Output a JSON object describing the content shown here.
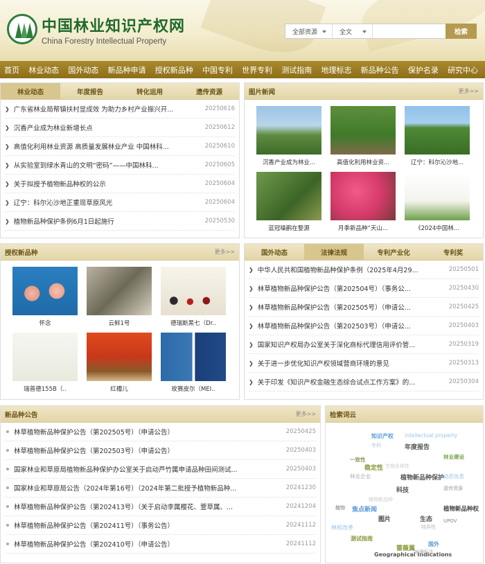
{
  "site": {
    "title_cn": "中国林业知识产权网",
    "title_en": "China Forestry Intellectual Property"
  },
  "search": {
    "scope": "全部资源",
    "field": "全文",
    "placeholder": "",
    "button": "检索"
  },
  "nav": [
    "首页",
    "林业动态",
    "国外动态",
    "新品种申请",
    "授权新品种",
    "中国专利",
    "世界专利",
    "测试指南",
    "地理标志",
    "新品种公告",
    "保护名录",
    "研究中心"
  ],
  "news": {
    "tabs": [
      "林业动态",
      "年度报告",
      "转化运用",
      "遗传资源"
    ],
    "items": [
      {
        "title": "广东省林业局帮镇扶村显成效 为助力乡村产业振兴开...",
        "date": "20250616"
      },
      {
        "title": "沉香产业成为林业新增长点",
        "date": "20250612"
      },
      {
        "title": "高值化利用林业资源 高质量发展林业产业 中国林科...",
        "date": "20250610"
      },
      {
        "title": "从实验室到绿水青山的文明“密码”——中国林科...",
        "date": "20250605"
      },
      {
        "title": "关于拟授予植物新品种权的公示",
        "date": "20250604"
      },
      {
        "title": "辽宁：科尔沁沙地正重现草原风光",
        "date": "20250604"
      },
      {
        "title": "植物新品种保护条例6月1日起施行",
        "date": "20250530"
      }
    ]
  },
  "photo_news": {
    "title": "图片新闻",
    "more": "更多>>",
    "items": [
      "沉香产业成为林业...",
      "高值化利用林业资...",
      "辽宁：科尔沁沙地...",
      "蓝冠噪鹛在婺源",
      "月季新品种“天山...",
      "《2024中国林..."
    ]
  },
  "varieties": {
    "title": "授权新品种",
    "more": "更多>>",
    "items": [
      "怀念",
      "云鲜1号",
      "德瑞斯黑七（Dr..",
      "瑞普德155B（..",
      "红槽儿",
      "玫赛皮尔（MEI.."
    ]
  },
  "law": {
    "tabs": [
      "国外动态",
      "法律法规",
      "专利产业化",
      "专利奖"
    ],
    "items": [
      {
        "title": "中华人民共和国植物新品种保护条例（2025年4月29...",
        "date": "20250501"
      },
      {
        "title": "林草植物新品种保护公告（第202504号）（事务公...",
        "date": "20250430"
      },
      {
        "title": "林草植物新品种保护公告（第202505号）（申请公...",
        "date": "20250425"
      },
      {
        "title": "林草植物新品种保护公告（第202503号）（申请公...",
        "date": "20250403"
      },
      {
        "title": "国家知识产权局办公室关于深化商标代理信用评价管...",
        "date": "20250319"
      },
      {
        "title": "关于进一步优化知识产权领域营商环境的意见",
        "date": "20250313"
      },
      {
        "title": "关于印发《知识产权金融生态综合试点工作方案》的...",
        "date": "20250304"
      }
    ]
  },
  "notices": {
    "title": "新品种公告",
    "more": "更多>>",
    "items": [
      {
        "title": "林草植物新品种保护公告（第202505号）（申请公告）",
        "date": "20250425"
      },
      {
        "title": "林草植物新品种保护公告（第202503号）（申请公告）",
        "date": "20250403"
      },
      {
        "title": "国家林业和草原局植物新品种保护办公室关于启动芦竹属申请品种田间测试...",
        "date": "20250403"
      },
      {
        "title": "国家林业和草原局公告（2024年第16号）（2024年第二批授予植物新品种...",
        "date": "20241230"
      },
      {
        "title": "林草植物新品种保护公告（第202413号）（关于启动李属樱花、萱草属、...",
        "date": "20241204"
      },
      {
        "title": "林草植物新品种保护公告（第202411号）（事务公告）",
        "date": "20241112"
      },
      {
        "title": "林草植物新品种保护公告（第202410号）（申请公告）",
        "date": "20241112"
      }
    ]
  },
  "cloud": {
    "title": "检索词云",
    "words": [
      "知识产权",
      "intellectual property",
      "专利",
      "年度报告",
      "林业建设",
      "一致性",
      "稳定性",
      "生物多样性",
      "林业企业",
      "植物新品种保护",
      "动态信息",
      "科技",
      "遗传资源",
      "植物新品种",
      "植物",
      "焦点新闻",
      "植物新品种权",
      "图片",
      "生态",
      "UPOV",
      "林权改革",
      "特异性",
      "测试指南",
      "蔷薇属",
      "国外",
      "Geographical Indications",
      "地理标志"
    ]
  },
  "colors": {
    "brand": "#1f6b2a",
    "nav": "#9a7a1e",
    "header_tab": "#e3d6a8"
  }
}
